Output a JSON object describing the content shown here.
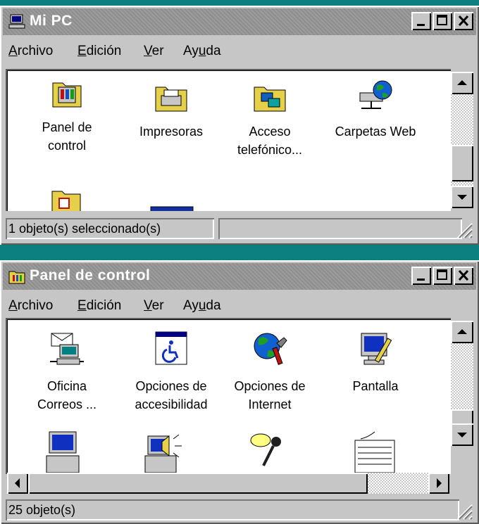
{
  "win1": {
    "title": "Mi PC",
    "menu": [
      "Archivo",
      "Edición",
      "Ver",
      "Ayuda"
    ],
    "items": [
      {
        "label1": "Panel de",
        "label2": "control",
        "icon": "folder-control-panel-icon"
      },
      {
        "label1": "Impresoras",
        "label2": "",
        "icon": "printer-folder-icon"
      },
      {
        "label1": "Acceso",
        "label2": "telefónico...",
        "icon": "dialup-folder-icon"
      },
      {
        "label1": "Carpetas Web",
        "label2": "",
        "icon": "web-folders-icon"
      }
    ],
    "status": "1 objeto(s) seleccionado(s)"
  },
  "win2": {
    "title": "Panel de control",
    "menu": [
      "Archivo",
      "Edición",
      "Ver",
      "Ayuda"
    ],
    "items": [
      {
        "label1": "Oficina",
        "label2": "Correos ...",
        "icon": "network-mail-icon"
      },
      {
        "label1": "Opciones de",
        "label2": "accesibilidad",
        "icon": "accessibility-icon"
      },
      {
        "label1": "Opciones de",
        "label2": "Internet",
        "icon": "internet-options-icon"
      },
      {
        "label1": "Pantalla",
        "label2": "",
        "icon": "display-icon"
      }
    ],
    "status": "25 objeto(s)"
  },
  "buttons": {
    "minimize": "_",
    "maximize": "□",
    "close": "×"
  }
}
